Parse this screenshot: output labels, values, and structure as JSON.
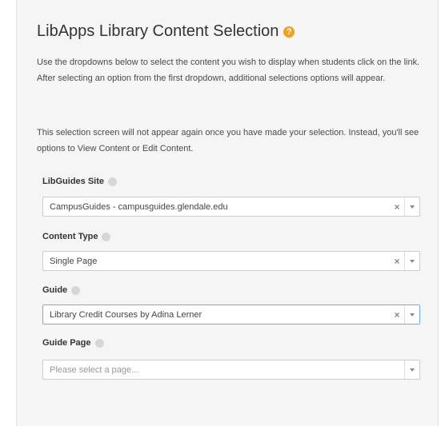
{
  "header": {
    "title": "LibApps Library Content Selection",
    "help_icon": "question-circle-icon"
  },
  "instructions": {
    "paragraph1": "Use the dropdowns below to select the content you wish to display when students click on the link. After selecting an option from the first dropdown, additional selections options will appear.",
    "paragraph2": "This selection screen will not appear again once you have made your selection. Instead, you'll see options to View Content or Edit Content."
  },
  "fields": {
    "site": {
      "label": "LibGuides Site",
      "value": "CampusGuides - campusguides.glendale.edu",
      "clear": "×"
    },
    "content_type": {
      "label": "Content Type",
      "value": "Single Page",
      "clear": "×"
    },
    "guide": {
      "label": "Guide",
      "value": "Library Credit Courses by Adina Lerner",
      "clear": "×"
    },
    "guide_page": {
      "label": "Guide Page",
      "placeholder": "Please select a page..."
    }
  },
  "icons": {
    "help": "question-circle-icon",
    "info": "info-circle-icon",
    "clear": "clear-icon",
    "dropdown": "chevron-down-icon"
  },
  "colors": {
    "accent_help": "#f0a11e",
    "focus_border": "#66afe9",
    "panel_bg": "#f5f5f5"
  }
}
